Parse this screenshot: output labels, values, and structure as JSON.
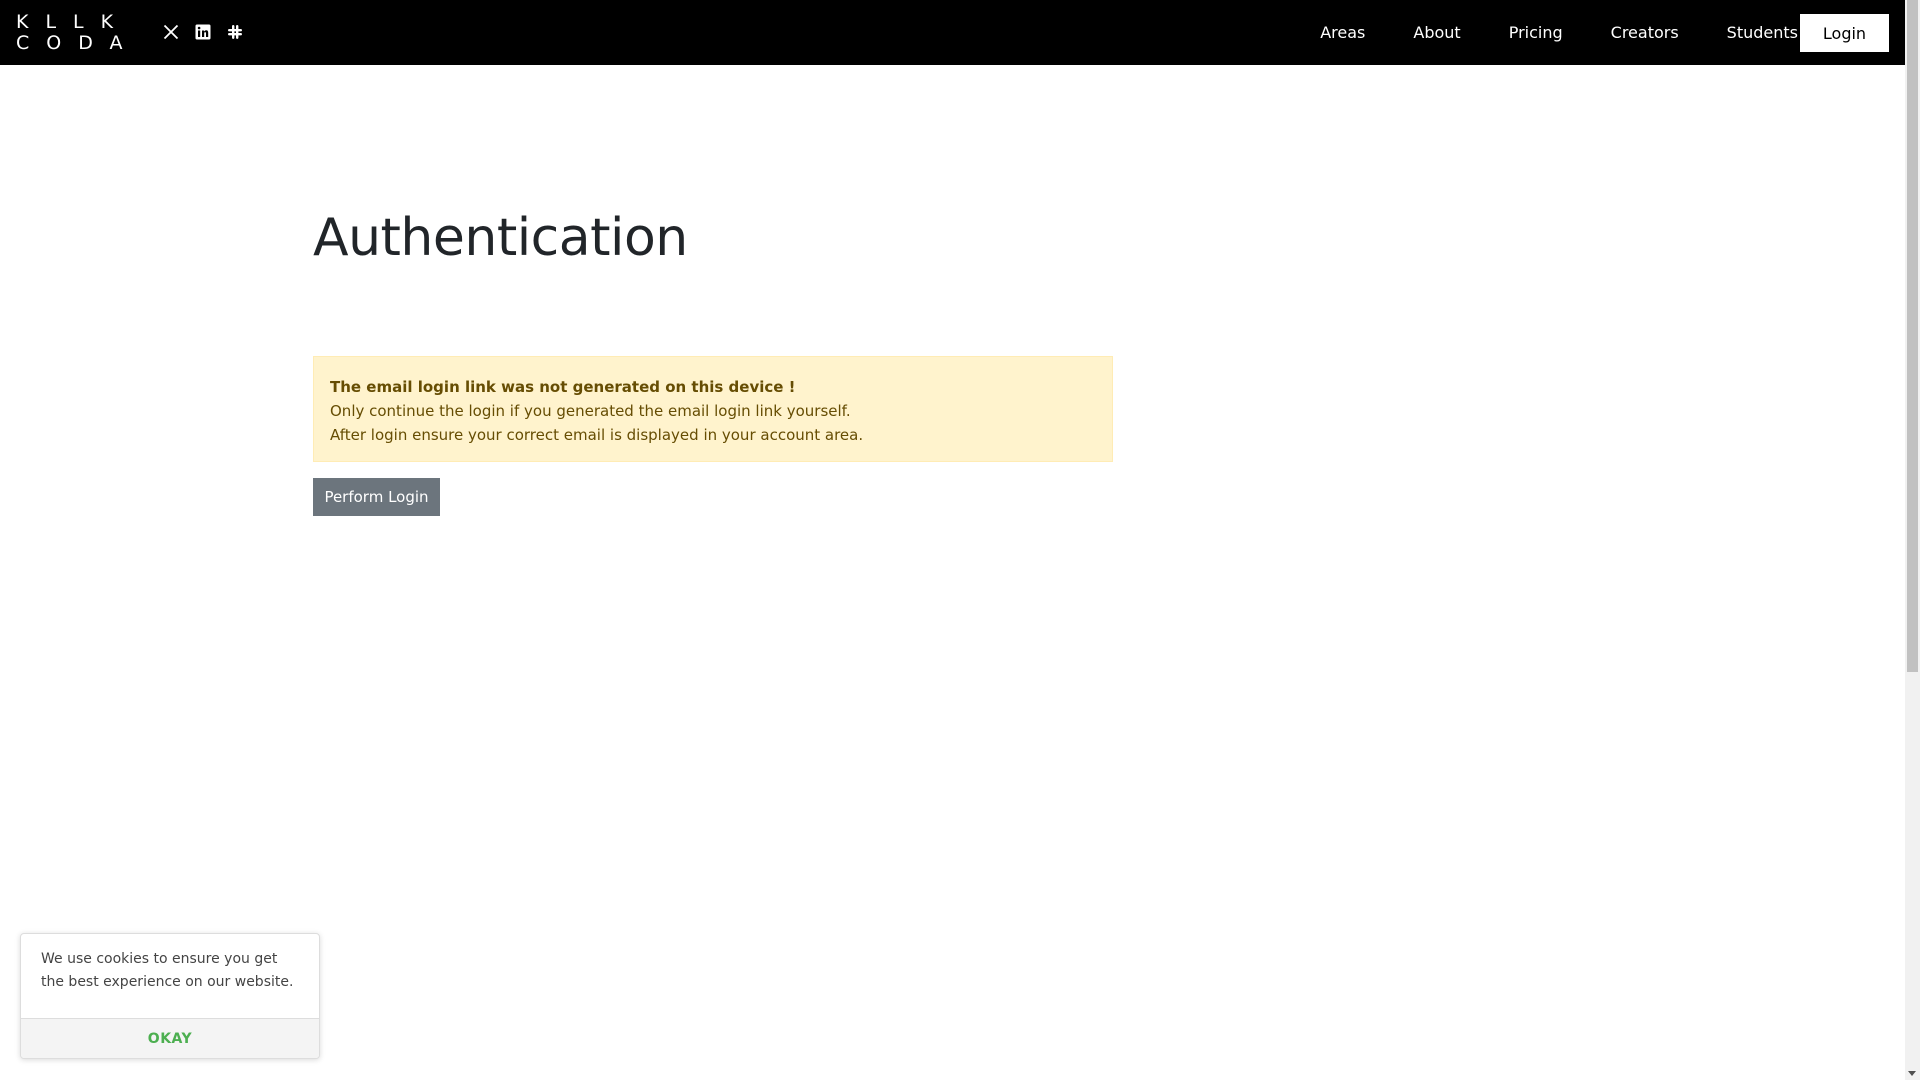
{
  "navbar": {
    "logo": {
      "line1": "KLLK",
      "line2": "CODA"
    },
    "social_icons": [
      "x-twitter-icon",
      "linkedin-icon",
      "slack-icon"
    ],
    "links": [
      "Areas",
      "About",
      "Pricing",
      "Creators",
      "Students"
    ],
    "login_label": "Login"
  },
  "main": {
    "title": "Authentication",
    "alert": {
      "heading": "The email login link was not generated on this device !",
      "line1": "Only continue the login if you generated the email login link yourself.",
      "line2": "After login ensure your correct email is displayed in your account area."
    },
    "perform_login_label": "Perform Login"
  },
  "cookie_banner": {
    "text": "We use cookies to ensure you get the best experience on our website.",
    "ok_label": "OKAY"
  },
  "colors": {
    "navbar_bg": "#000000",
    "alert_bg": "#fff3cd",
    "alert_text": "#664d03",
    "button_secondary": "#6c757d",
    "cookie_ok": "#4caf50"
  }
}
